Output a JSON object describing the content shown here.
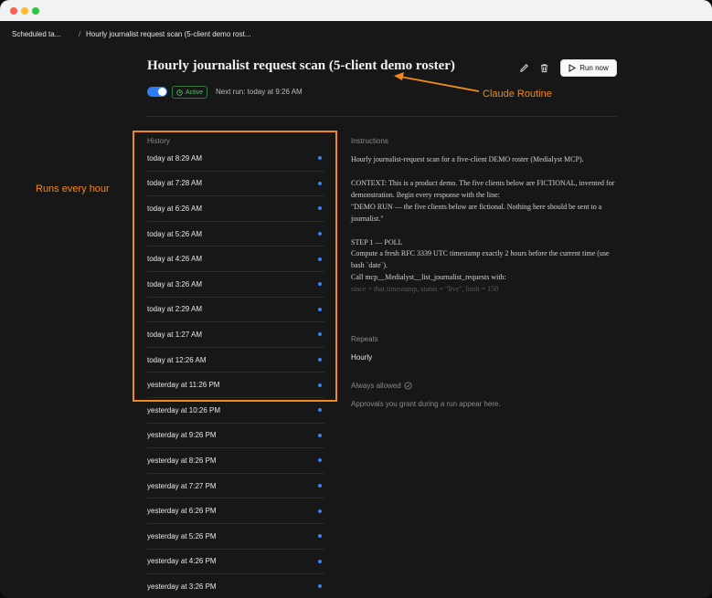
{
  "breadcrumb": {
    "parent": "Scheduled ta...",
    "separator": "/",
    "current": "Hourly journalist request scan (5-client demo rost..."
  },
  "header": {
    "title": "Hourly journalist request scan (5-client demo roster)",
    "edit_icon": "pencil-icon",
    "delete_icon": "trash-icon",
    "run_now_label": "Run now"
  },
  "status": {
    "enabled": true,
    "badge_label": "Active",
    "next_run": "Next run: today at 9:26 AM"
  },
  "history": {
    "label": "History",
    "items": [
      {
        "time": "today at 8:29 AM"
      },
      {
        "time": "today at 7:28 AM"
      },
      {
        "time": "today at 6:26 AM"
      },
      {
        "time": "today at 5:26 AM"
      },
      {
        "time": "today at 4:26 AM"
      },
      {
        "time": "today at 3:26 AM"
      },
      {
        "time": "today at 2:29 AM"
      },
      {
        "time": "today at 1:27 AM"
      },
      {
        "time": "today at 12:26 AM"
      },
      {
        "time": "yesterday at 11:26 PM"
      },
      {
        "time": "yesterday at 10:26 PM"
      },
      {
        "time": "yesterday at 9:26 PM"
      },
      {
        "time": "yesterday at 8:26 PM"
      },
      {
        "time": "yesterday at 7:27 PM"
      },
      {
        "time": "yesterday at 6:26 PM"
      },
      {
        "time": "yesterday at 5:26 PM"
      },
      {
        "time": "yesterday at 4:26 PM"
      },
      {
        "time": "yesterday at 3:26 PM"
      }
    ]
  },
  "instructions": {
    "label": "Instructions",
    "p1": "Hourly journalist-request scan for a five-client DEMO roster (Medialyst MCP).",
    "p2": "CONTEXT: This is a product demo. The five clients below are FICTIONAL, invented for demonstration. Begin every response with the line:",
    "p3": "\"DEMO RUN — the five clients below are fictional. Nothing here should be sent to a journalist.\"",
    "p4": "STEP 1 — POLL",
    "p5": "Compute a fresh RFC 3339 UTC timestamp exactly 2 hours before the current time (use bash `date`).",
    "p6": "Call mcp__Medialyst__list_journalist_requests with:",
    "p7": "since = that timestamp, status = \"live\", limit = 150"
  },
  "repeats": {
    "label": "Repeats",
    "value": "Hourly"
  },
  "permissions": {
    "label": "Always allowed",
    "description": "Approvals you grant during a run appear here."
  },
  "annotations": {
    "runs_every_hour": "Runs every hour",
    "claude_routine": "Claude Routine",
    "color": "#f08a1c"
  }
}
